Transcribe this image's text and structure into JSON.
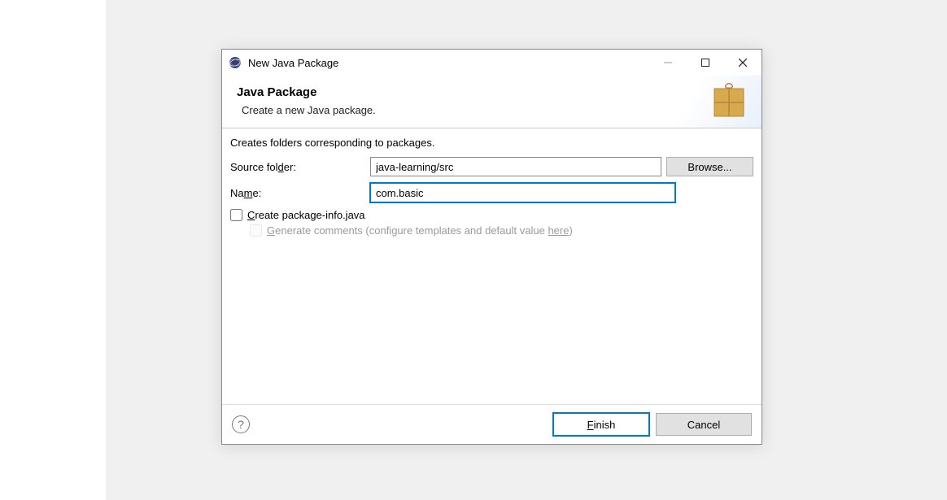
{
  "window": {
    "title": "New Java Package"
  },
  "banner": {
    "heading": "Java Package",
    "subheading": "Create a new Java package."
  },
  "form": {
    "description": "Creates folders corresponding to packages.",
    "sourceFolder": {
      "label_pre": "Source fol",
      "label_u": "d",
      "label_post": "er:",
      "value": "java-learning/src",
      "browse": "Browse..."
    },
    "name": {
      "label_pre": "Na",
      "label_u": "m",
      "label_post": "e:",
      "value": "com.basic"
    },
    "createPkgInfo": {
      "label_pre": "",
      "label_u": "C",
      "label_post": "reate package-info.java"
    },
    "generateComments": {
      "label_pre": "",
      "label_u": "G",
      "label_post_a": "enerate comments (configure templates and default value ",
      "label_link": "here",
      "label_post_b": ")"
    }
  },
  "buttons": {
    "finish_pre": "",
    "finish_u": "F",
    "finish_post": "inish",
    "cancel": "Cancel"
  }
}
